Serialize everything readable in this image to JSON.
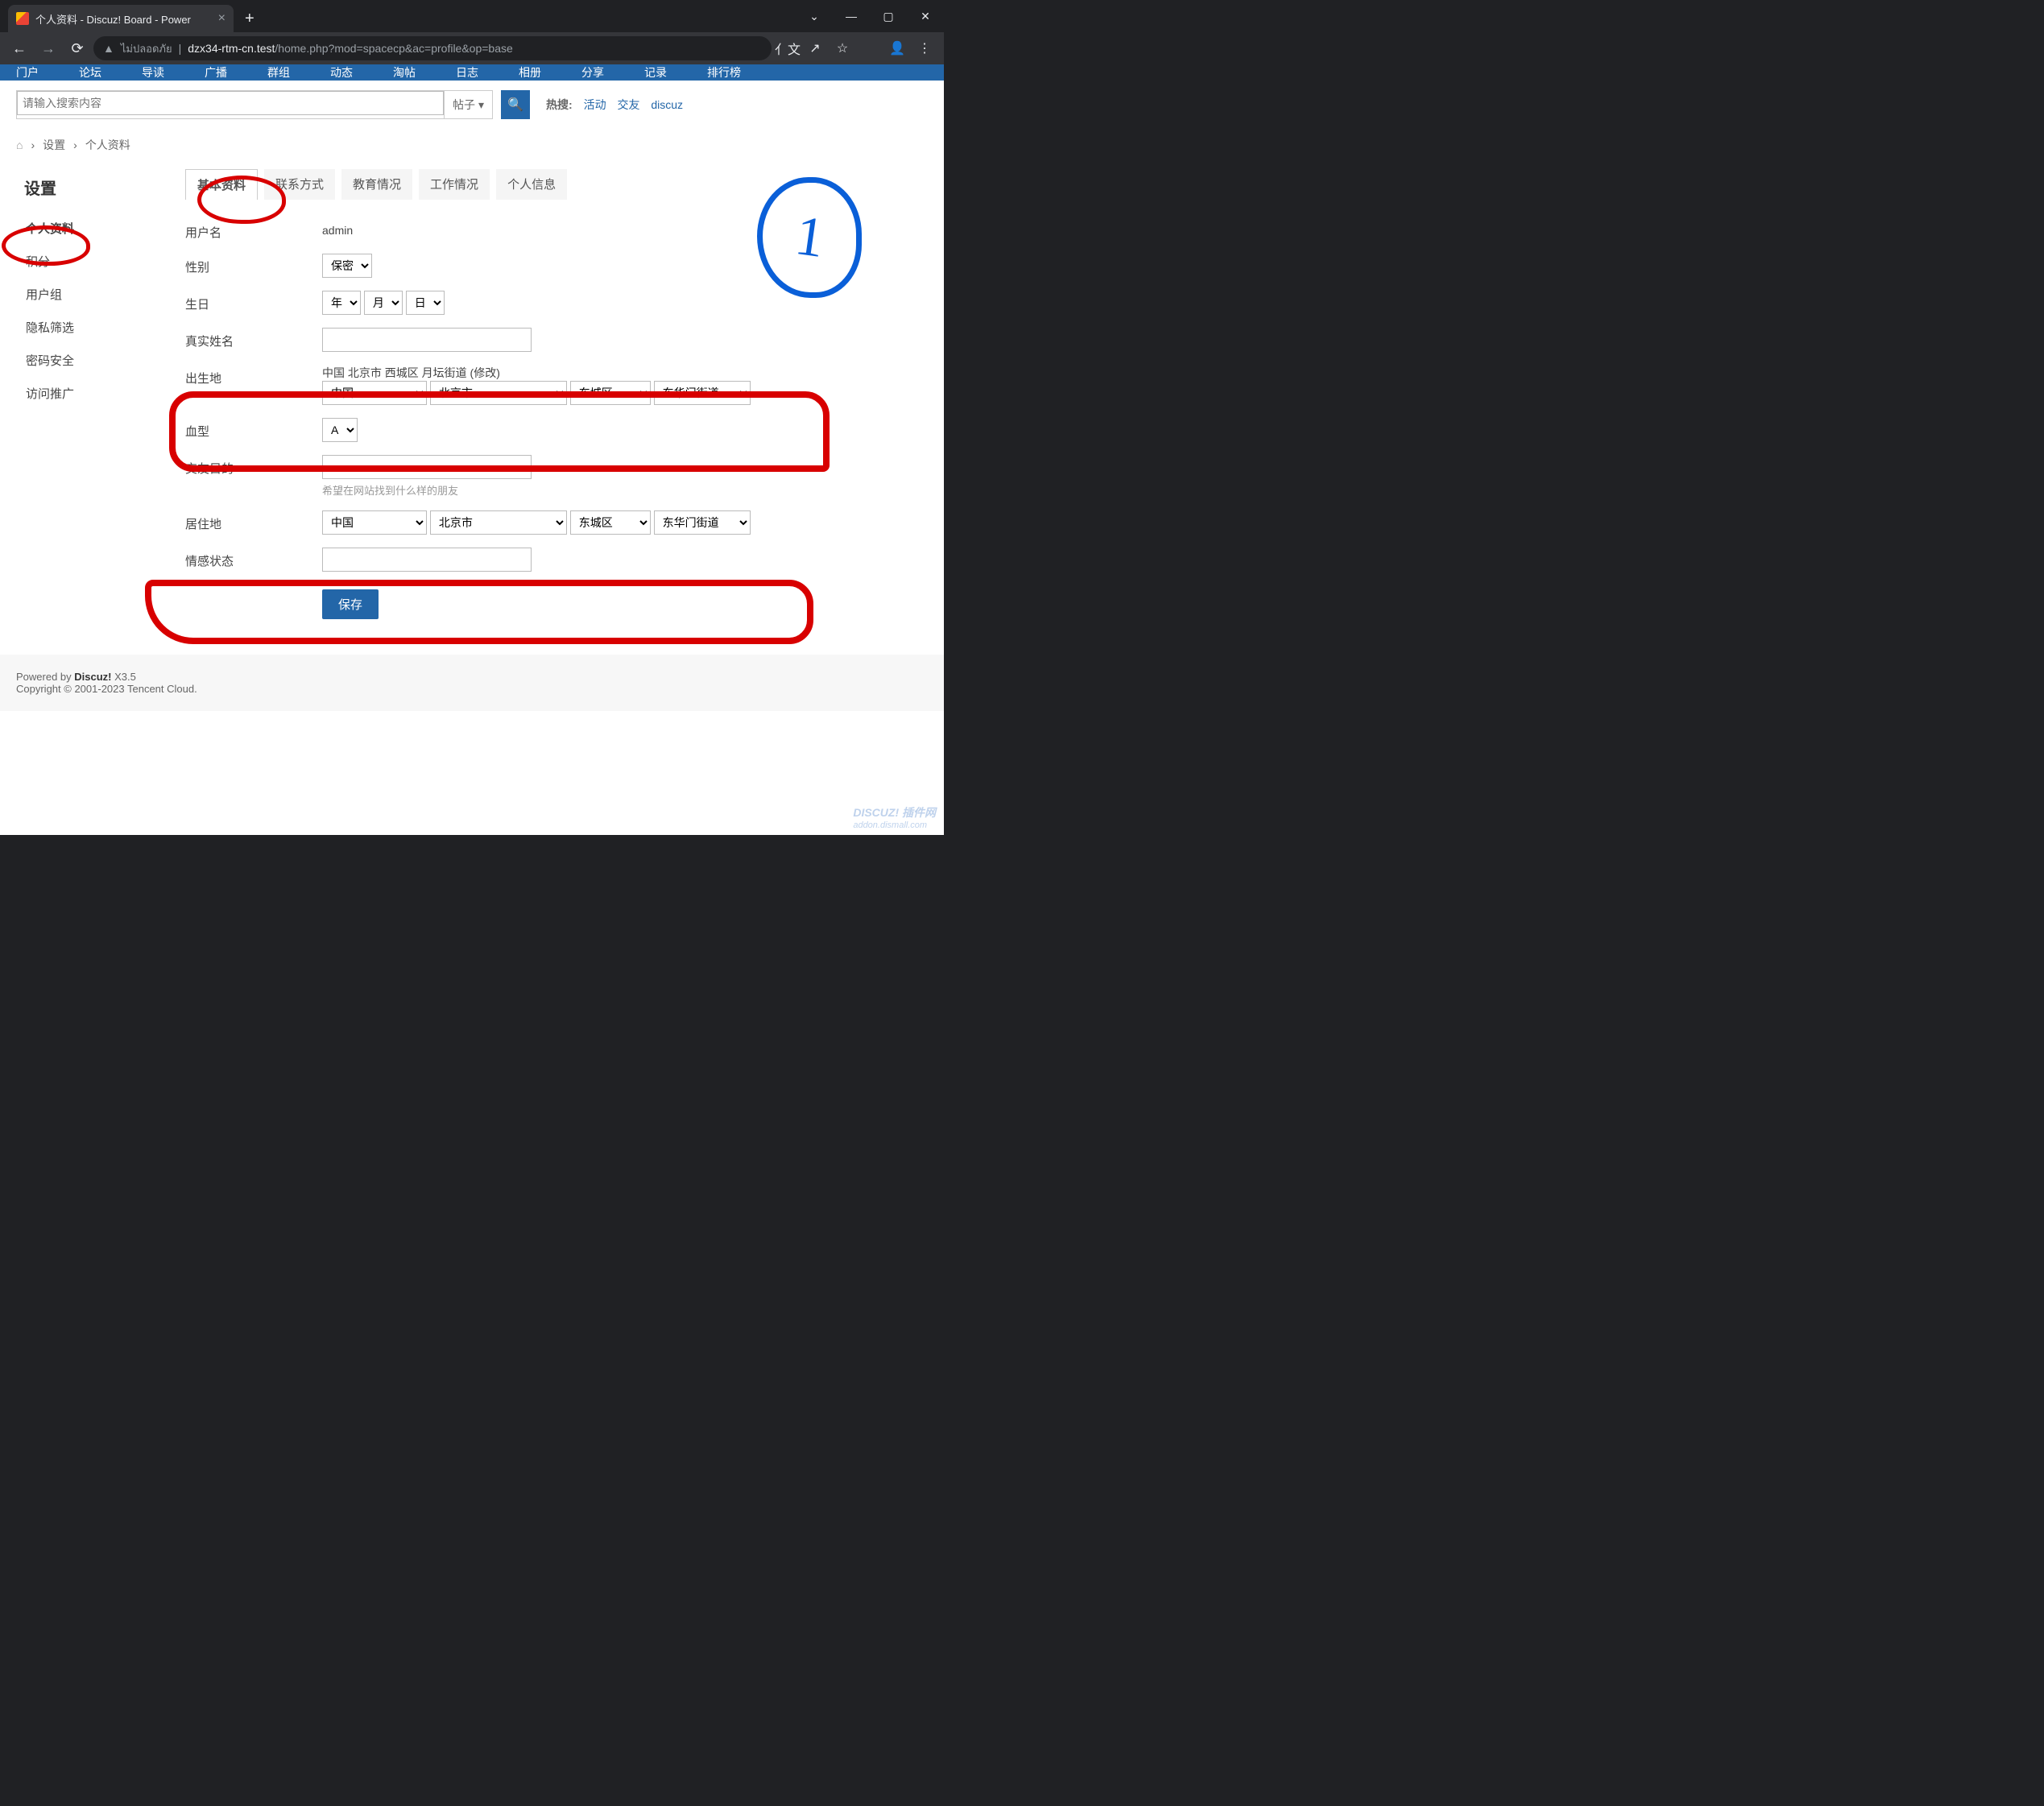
{
  "browser": {
    "tab_title": "个人资料 - Discuz! Board - Power",
    "url_warn": "ไม่ปลอดภัย",
    "url_host": "dzx34-rtm-cn.test",
    "url_path": "/home.php?mod=spacecp&ac=profile&op=base"
  },
  "topnav": [
    "门户",
    "论坛",
    "导读",
    "广播",
    "群组",
    "动态",
    "淘帖",
    "日志",
    "相册",
    "分享",
    "记录",
    "排行榜"
  ],
  "search": {
    "placeholder": "请输入搜索内容",
    "type": "帖子",
    "hot_label": "热搜:",
    "hot": [
      "活动",
      "交友",
      "discuz"
    ]
  },
  "crumb": {
    "a": "设置",
    "b": "个人资料"
  },
  "sidebar": {
    "title": "设置",
    "items": [
      "个人资料",
      "积分",
      "用户组",
      "隐私筛选",
      "密码安全",
      "访问推广"
    ],
    "active": 0
  },
  "tabs": {
    "items": [
      "基本资料",
      "联系方式",
      "教育情况",
      "工作情况",
      "个人信息"
    ],
    "active": 0
  },
  "form": {
    "username_label": "用户名",
    "username_value": "admin",
    "gender_label": "性别",
    "gender_value": "保密",
    "birthday_label": "生日",
    "bd_year": "年",
    "bd_month": "月",
    "bd_day": "日",
    "realname_label": "真实姓名",
    "birthplace_label": "出生地",
    "birthplace_text": "中国 北京市 西城区 月坛街道 (修改)",
    "bp_country": "中国",
    "bp_prov": "北京市",
    "bp_city": "东城区",
    "bp_dist": "东华门街道",
    "blood_label": "血型",
    "blood_value": "A",
    "friend_goal_label": "交友目的",
    "friend_goal_hint": "希望在网站找到什么样的朋友",
    "residence_label": "居住地",
    "res_country": "中国",
    "res_prov": "北京市",
    "res_city": "东城区",
    "res_dist": "东华门街道",
    "emotion_label": "情感状态",
    "save_label": "保存"
  },
  "footer": {
    "powered": "Powered by ",
    "product": "Discuz!",
    "version": " X3.5",
    "copyright": "Copyright © 2001-2023 Tencent Cloud."
  },
  "annotation": {
    "number": "1"
  },
  "watermark": {
    "logo": "DISCUZ! 插件网",
    "sub": "addon.dismall.com"
  }
}
